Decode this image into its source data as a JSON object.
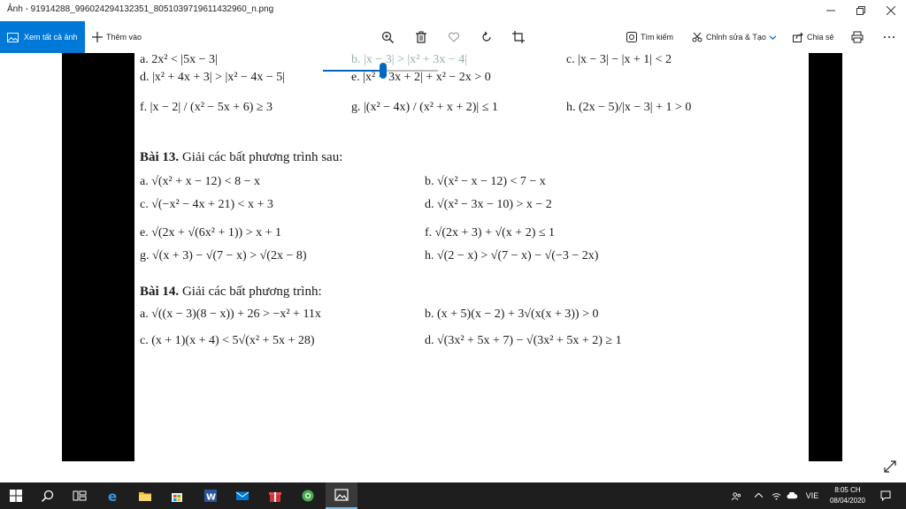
{
  "window": {
    "title": "Ảnh - 91914288_996024294132351_8051039719611432960_n.png"
  },
  "toolbar": {
    "see_all": "Xem tất cả ảnh",
    "add_to": "Thêm vào",
    "find": "Tìm kiếm",
    "edit_create": "Chỉnh sửa & Tạo",
    "share": "Chia sẻ"
  },
  "zoom": {
    "level_fraction": 0.52
  },
  "document": {
    "row1": {
      "a": "a. 2x² < |5x − 3|",
      "b": "b. |x − 3| > |x² + 3x − 4|",
      "c": "c. |x − 3| − |x + 1| < 2"
    },
    "row2": {
      "d": "d. |x² + 4x + 3| > |x² − 4x − 5|",
      "e": "e. |x² − 3x + 2| + x² − 2x > 0"
    },
    "row3": {
      "f": "f. |x − 2| / (x² − 5x + 6) ≥ 3",
      "g": "g. |(x² − 4x) / (x² + x + 2)| ≤ 1",
      "h": "h. (2x − 5)/|x − 3| + 1 > 0"
    },
    "bai13_title": "Bài 13.",
    "bai13_text": "Giải các bất phương trình sau:",
    "bai13": {
      "a": "a. √(x² + x − 12) < 8 − x",
      "b": "b. √(x² − x − 12) < 7 − x",
      "c": "c. √(−x² − 4x + 21) < x + 3",
      "d": "d. √(x² − 3x − 10) > x − 2",
      "e": "e. √(2x + √(6x² + 1)) > x + 1",
      "f": "f. √(2x + 3) + √(x + 2) ≤ 1",
      "g": "g. √(x + 3) − √(7 − x) > √(2x − 8)",
      "h": "h. √(2 − x) > √(7 − x) − √(−3 − 2x)"
    },
    "bai14_title": "Bài 14.",
    "bai14_text": "Giải các bất phương trình:",
    "bai14": {
      "a": "a. √((x − 3)(8 − x)) + 26 > −x² + 11x",
      "b": "b. (x + 5)(x − 2) + 3√(x(x + 3)) > 0",
      "c": "c. (x + 1)(x + 4) < 5√(x² + 5x + 28)",
      "d": "d. √(3x² + 5x + 7) − √(3x² + 5x + 2) ≥ 1"
    }
  },
  "taskbar": {
    "language": "VIE",
    "time": "8:05 CH",
    "date": "08/04/2020"
  },
  "colors": {
    "accent": "#0078d7",
    "taskbar": "#1e1e1e",
    "letterbox": "#000000"
  }
}
